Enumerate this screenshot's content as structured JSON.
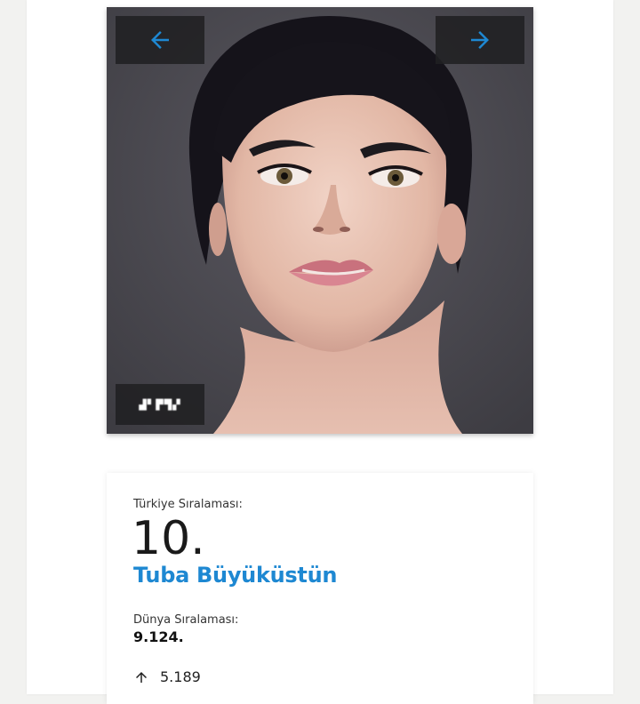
{
  "gallery": {
    "prev_icon": "arrow-left-icon",
    "next_icon": "arrow-right-icon",
    "badge_text": "▟▘▛▜▞",
    "accent_color": "#1e88d2"
  },
  "ranking": {
    "turkey_label": "Türkiye Sıralaması:",
    "turkey_rank": "10.",
    "name": "Tuba Büyüküstün",
    "world_label": "Dünya Sıralaması:",
    "world_rank": "9.124.",
    "change_icon": "arrow-up-icon",
    "change_value": "5.189"
  }
}
